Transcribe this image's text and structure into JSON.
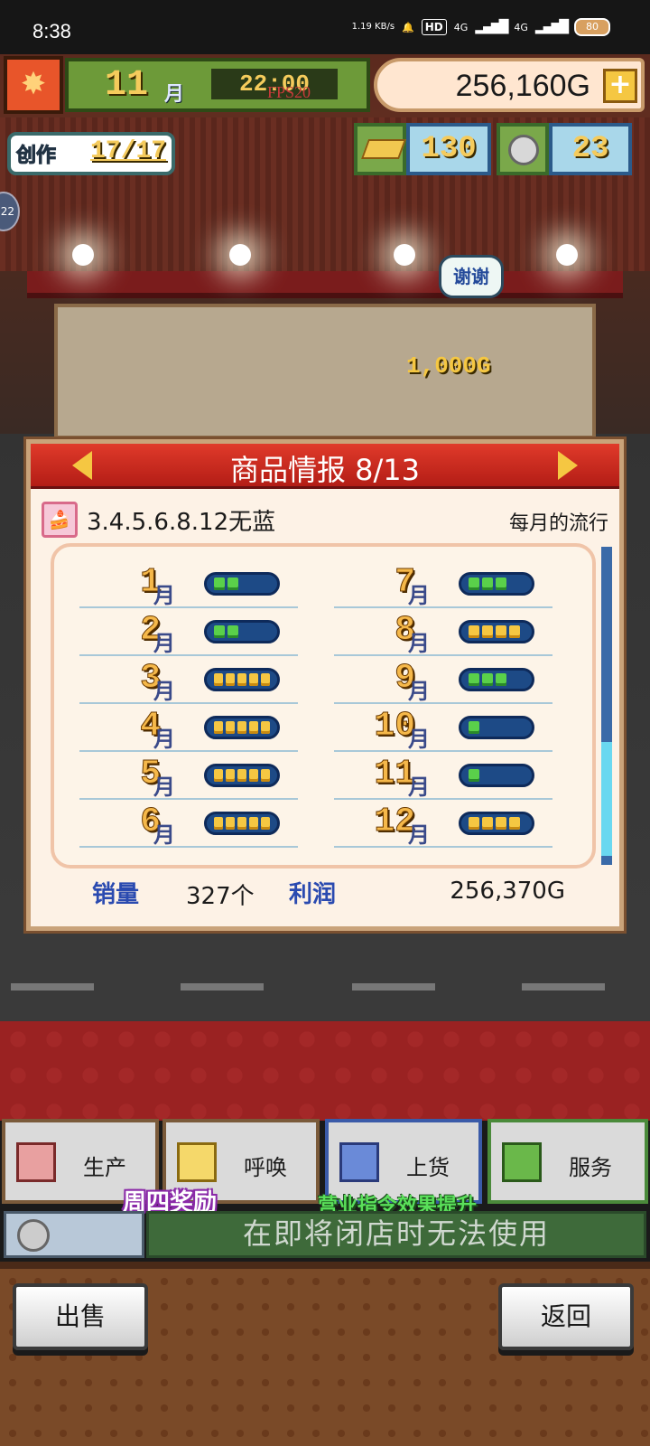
{
  "status_bar": {
    "time": "8:38",
    "speed": "1.19 KB/s",
    "hd": "HD",
    "network1": "4G",
    "network2": "4G",
    "battery": "80"
  },
  "hud": {
    "month_number": "11",
    "month_unit": "月",
    "clock": "22:00",
    "fps": "FPS20",
    "money": "256,160G",
    "plus_label": "+",
    "craft_label": "创作",
    "craft_value": "17/17",
    "gold_bars": "130",
    "coins": "23",
    "side_badge": "22"
  },
  "scene": {
    "speech_bubble": "谢谢",
    "coin_popup": "1,000G"
  },
  "panel": {
    "title": "商品情报 8/13",
    "product_name": "3.4.5.6.8.12无蓝",
    "trend_label": "每月的流行",
    "months_left": [
      {
        "num": "1",
        "unit": "月",
        "level": 2,
        "color": "green"
      },
      {
        "num": "2",
        "unit": "月",
        "level": 2,
        "color": "green"
      },
      {
        "num": "3",
        "unit": "月",
        "level": 5,
        "color": "yellow"
      },
      {
        "num": "4",
        "unit": "月",
        "level": 5,
        "color": "yellow"
      },
      {
        "num": "5",
        "unit": "月",
        "level": 5,
        "color": "yellow"
      },
      {
        "num": "6",
        "unit": "月",
        "level": 5,
        "color": "yellow"
      }
    ],
    "months_right": [
      {
        "num": "7",
        "unit": "月",
        "level": 3,
        "color": "green"
      },
      {
        "num": "8",
        "unit": "月",
        "level": 4,
        "color": "yellow"
      },
      {
        "num": "9",
        "unit": "月",
        "level": 3,
        "color": "green"
      },
      {
        "num": "10",
        "unit": "月",
        "level": 1,
        "color": "green"
      },
      {
        "num": "11",
        "unit": "月",
        "level": 1,
        "color": "green"
      },
      {
        "num": "12",
        "unit": "月",
        "level": 4,
        "color": "yellow"
      }
    ],
    "sales_label": "销量",
    "sales_value": "327个",
    "profit_label": "利润",
    "profit_value": "256,370G"
  },
  "menu": {
    "produce": "生产",
    "call": "呼唤",
    "stock": "上货",
    "service": "服务",
    "thursday_reward": "周四奖励",
    "boost_text": "营业指令效果提升",
    "notice": "在即将闭店时无法使用"
  },
  "footer": {
    "sell": "出售",
    "back": "返回"
  },
  "colors": {
    "panel_header": "#c0261c",
    "bar_green": "#5ad04a",
    "bar_yellow": "#f5c742",
    "bar_bg": "#1d4a86"
  }
}
